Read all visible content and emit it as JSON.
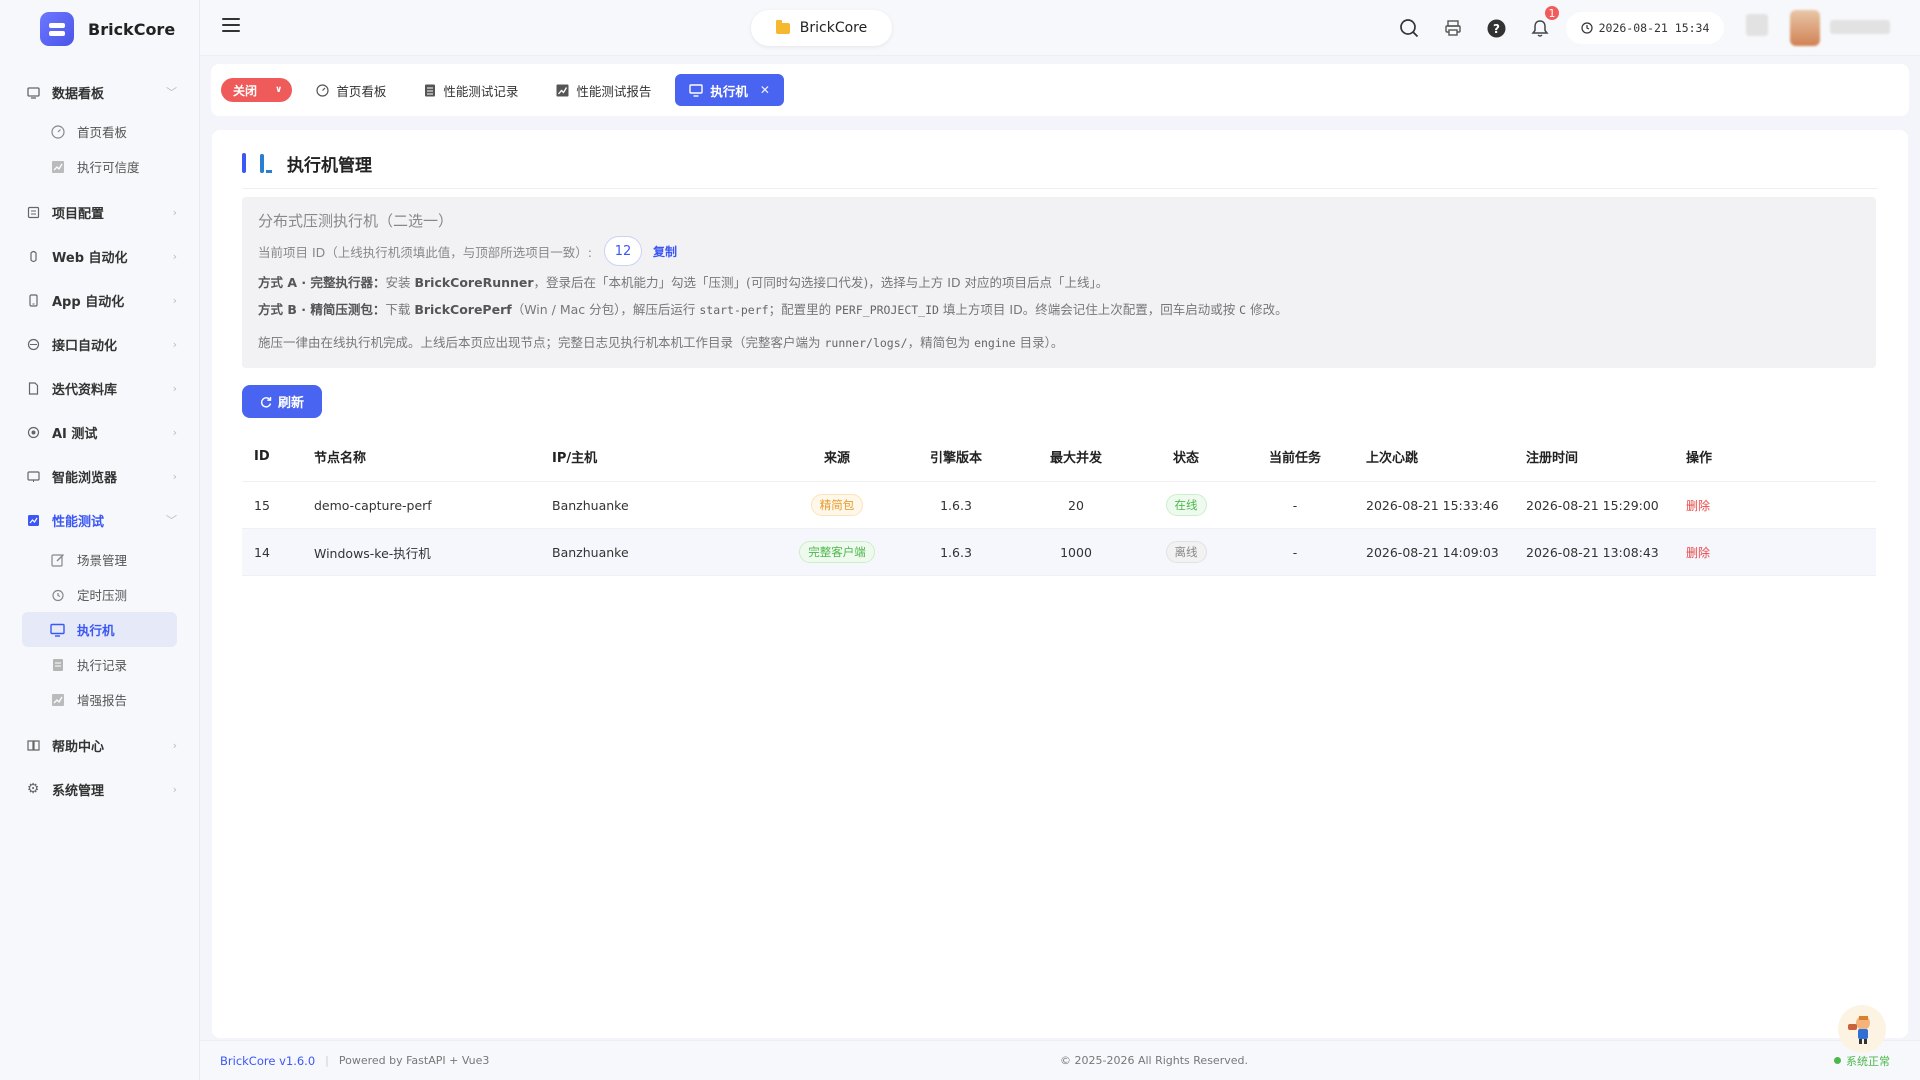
{
  "app": {
    "name": "BrickCore"
  },
  "sidebar": {
    "groups": [
      {
        "label": "数据看板",
        "icon": "dashboard-icon",
        "expanded": true,
        "items": [
          {
            "label": "首页看板",
            "icon": "gauge-icon"
          },
          {
            "label": "执行可信度",
            "icon": "chart-icon"
          }
        ]
      },
      {
        "label": "项目配置",
        "icon": "project-icon"
      },
      {
        "label": "Web 自动化",
        "icon": "web-icon"
      },
      {
        "label": "App 自动化",
        "icon": "mobile-icon"
      },
      {
        "label": "接口自动化",
        "icon": "api-icon"
      },
      {
        "label": "迭代资料库",
        "icon": "document-icon"
      },
      {
        "label": "AI 测试",
        "icon": "ai-icon"
      },
      {
        "label": "智能浏览器",
        "icon": "browser-icon"
      },
      {
        "label": "性能测试",
        "icon": "perf-icon",
        "expanded": true,
        "active": true,
        "items": [
          {
            "label": "场景管理",
            "icon": "edit-icon"
          },
          {
            "label": "定时压测",
            "icon": "alarm-icon"
          },
          {
            "label": "执行机",
            "icon": "monitor-icon",
            "active": true
          },
          {
            "label": "执行记录",
            "icon": "list-icon"
          },
          {
            "label": "增强报告",
            "icon": "chart-icon"
          }
        ]
      },
      {
        "label": "帮助中心",
        "icon": "book-icon"
      },
      {
        "label": "系统管理",
        "icon": "gear-icon"
      }
    ]
  },
  "header": {
    "project": "BrickCore",
    "notifications": "1",
    "datetime": "2026-08-21 15:34"
  },
  "tabs": {
    "close_label": "关闭",
    "items": [
      {
        "label": "首页看板",
        "icon": "gauge-icon"
      },
      {
        "label": "性能测试记录",
        "icon": "list-icon"
      },
      {
        "label": "性能测试报告",
        "icon": "chart-icon"
      },
      {
        "label": "执行机",
        "icon": "monitor-icon",
        "active": true
      }
    ]
  },
  "page": {
    "title": "执行机管理",
    "info": {
      "heading": "分布式压测执行机（二选一）",
      "project_id_label": "当前项目 ID（上线执行机须填此值，与顶部所选项目一致）:",
      "project_id": "12",
      "copy_label": "复制",
      "mode_a_title": "方式 A · 完整执行器：",
      "mode_a_pre": "安装 ",
      "mode_a_product": "BrickCoreRunner",
      "mode_a_post": "，登录后在「本机能力」勾选「压测」(可同时勾选接口代发)，选择与上方 ID 对应的项目后点「上线」。",
      "mode_b_title": "方式 B · 精简压测包：",
      "mode_b_pre": "下载 ",
      "mode_b_product": "BrickCorePerf",
      "mode_b_mid1": "（Win / Mac 分包），解压后运行 ",
      "mode_b_cmd": "start-perf",
      "mode_b_mid2": "；配置里的 ",
      "mode_b_env": "PERF_PROJECT_ID",
      "mode_b_mid3": " 填上方项目 ID。终端会记住上次配置，回车启动或按 ",
      "mode_b_key": "C",
      "mode_b_post": " 修改。",
      "note_pre": "施压一律由在线执行机完成。上线后本页应出现节点；完整日志见执行机本机工作目录（完整客户端为 ",
      "note_path1": "runner/logs/",
      "note_mid": "，精简包为 ",
      "note_path2": "engine",
      "note_post": " 目录）。"
    },
    "refresh_label": "刷新",
    "table": {
      "headers": [
        "ID",
        "节点名称",
        "IP/主机",
        "来源",
        "引擎版本",
        "最大并发",
        "状态",
        "当前任务",
        "上次心跳",
        "注册时间",
        "操作"
      ],
      "rows": [
        {
          "id": "15",
          "name": "demo-capture-perf",
          "host": "Banzhuanke",
          "source": "精简包",
          "version": "1.6.3",
          "max": "20",
          "status": "在线",
          "task": "-",
          "heartbeat": "2026-08-21 15:33:46",
          "registered": "2026-08-21 15:29:00",
          "action": "删除"
        },
        {
          "id": "14",
          "name": "Windows-ke-执行机",
          "host": "Banzhuanke",
          "source": "完整客户端",
          "version": "1.6.3",
          "max": "1000",
          "status": "离线",
          "task": "-",
          "heartbeat": "2026-08-21 14:09:03",
          "registered": "2026-08-21 13:08:43",
          "action": "删除"
        }
      ]
    }
  },
  "footer": {
    "version": "BrickCore v1.6.0",
    "powered": "Powered by FastAPI + Vue3",
    "copyright": "© 2025-2026 All Rights Reserved.",
    "status": "系统正常"
  },
  "colors": {
    "accent": "#4a64f2",
    "danger": "#ef5a5a",
    "success": "#4cb84c",
    "warning": "#e79a2a"
  }
}
